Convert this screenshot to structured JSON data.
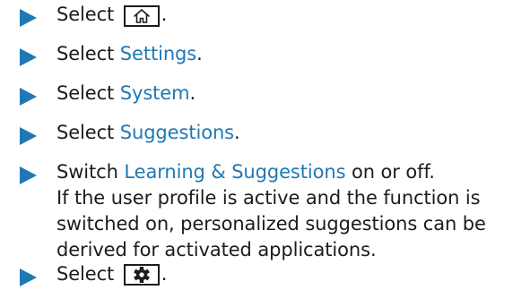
{
  "steps": [
    {
      "prefix": "Select",
      "icon": "home-icon",
      "suffix": "."
    },
    {
      "prefix": "Select ",
      "link": "Settings",
      "suffix": "."
    },
    {
      "prefix": "Select ",
      "link": "System",
      "suffix": "."
    },
    {
      "prefix": "Select ",
      "link": "Suggestions",
      "suffix": "."
    },
    {
      "prefix": "Switch ",
      "link": "Learning & Suggestions",
      "suffix": " on or off.",
      "description": [
        "If the user profile is active and the function is",
        "switched on, personalized suggestions can be",
        "derived for activated applications."
      ]
    },
    {
      "prefix": "Select",
      "icon": "gear-icon",
      "suffix": "."
    }
  ],
  "colors": {
    "accent": "#1f78b4",
    "text": "#1c1c1c"
  }
}
